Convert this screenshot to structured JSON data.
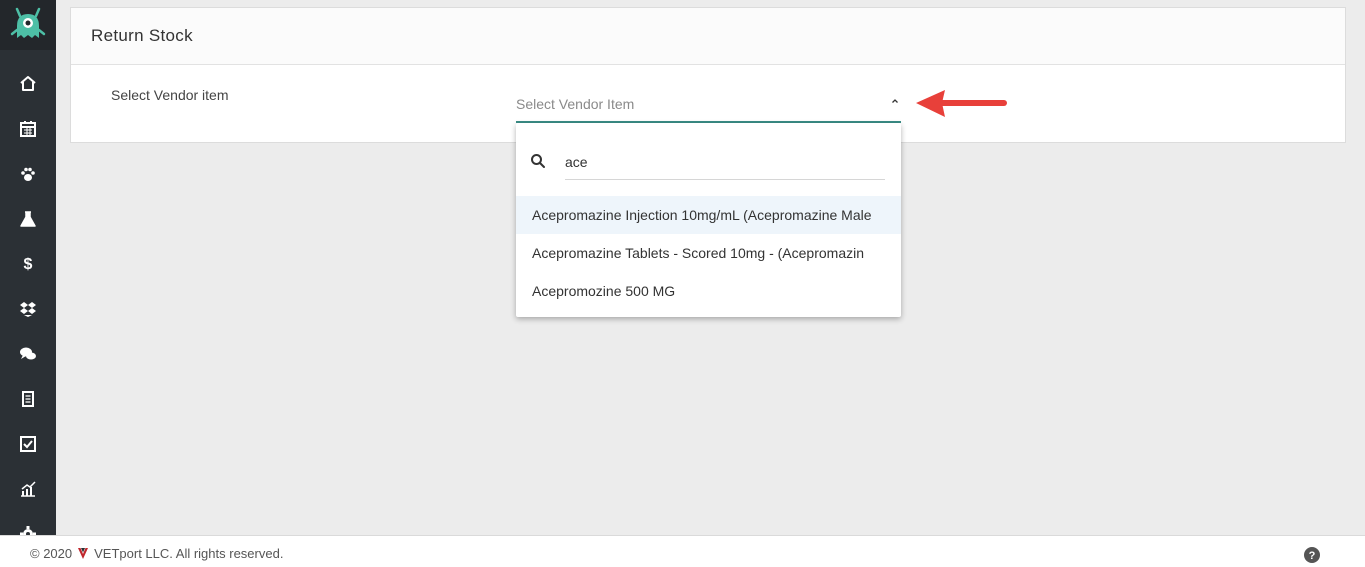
{
  "sidebar": {
    "logo_icon": "monster-logo-icon",
    "items": [
      {
        "icon": "home-icon"
      },
      {
        "icon": "calendar-icon"
      },
      {
        "icon": "paw-icon"
      },
      {
        "icon": "flask-icon"
      },
      {
        "icon": "dollar-icon"
      },
      {
        "icon": "dropbox-icon"
      },
      {
        "icon": "chat-icon"
      },
      {
        "icon": "document-icon"
      },
      {
        "icon": "checkbox-icon"
      },
      {
        "icon": "chart-icon"
      },
      {
        "icon": "gear-icon"
      }
    ],
    "background": "#2b3035"
  },
  "card": {
    "title": "Return Stock",
    "field_label": "Select Vendor item"
  },
  "select": {
    "placeholder": "Select Vendor Item",
    "accent": "#3a8d86"
  },
  "dropdown": {
    "search_value": "ace",
    "options": [
      {
        "label": "Acepromazine Injection 10mg/mL (Acepromazine Male"
      },
      {
        "label": "Acepromazine Tablets - Scored 10mg - (Acepromazin"
      },
      {
        "label": "Acepromozine 500 MG"
      }
    ]
  },
  "annotation": {
    "arrow_color": "#e8403a"
  },
  "footer": {
    "copyright_before": "© 2020",
    "copyright_after": "VETport LLC. All rights reserved."
  }
}
